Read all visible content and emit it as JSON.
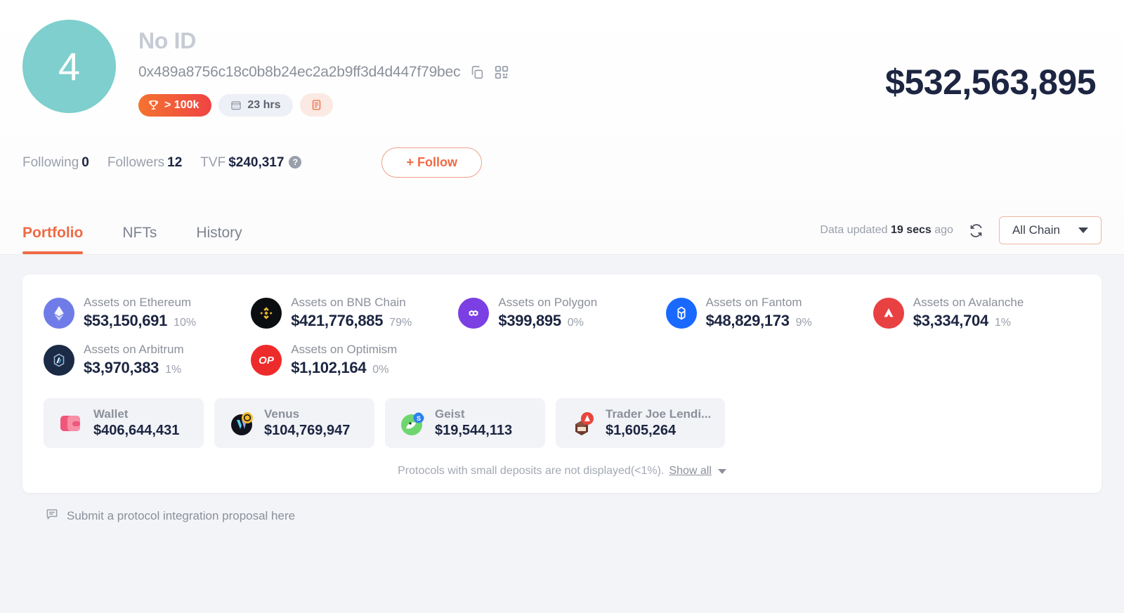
{
  "profile": {
    "avatar_rank": "4",
    "display_name": "No ID",
    "address": "0x489a8756c18c0b8b24ec2a2b9ff3d4d447f79bec",
    "copy_icon": "copy-icon",
    "qr_icon": "qr-code-icon",
    "rank_badge": "> 100k",
    "rank_badge_icon": "trophy-icon",
    "time_badge": "23 hrs",
    "time_badge_icon": "calendar-icon",
    "note_badge_icon": "note-icon",
    "total_value": "$532,563,895"
  },
  "stats": {
    "following_label": "Following",
    "following_value": "0",
    "followers_label": "Followers",
    "followers_value": "12",
    "tvf_label": "TVF",
    "tvf_value": "$240,317",
    "help_icon": "?",
    "follow_button": "+ Follow"
  },
  "tabs": {
    "items": [
      {
        "label": "Portfolio",
        "active": true
      },
      {
        "label": "NFTs",
        "active": false
      },
      {
        "label": "History",
        "active": false
      }
    ],
    "updated_prefix": "Data updated",
    "updated_value": "19 secs",
    "updated_suffix": "ago",
    "refresh_icon": "refresh-icon",
    "chain_filter": "All Chain"
  },
  "chains": [
    {
      "name": "Assets on Ethereum",
      "amount": "$53,150,691",
      "pct": "10%",
      "icon": "ethereum-icon",
      "color": "#6f7ce8"
    },
    {
      "name": "Assets on BNB Chain",
      "amount": "$421,776,885",
      "pct": "79%",
      "icon": "bnb-icon",
      "color": "#0b0e11"
    },
    {
      "name": "Assets on Polygon",
      "amount": "$399,895",
      "pct": "0%",
      "icon": "polygon-icon",
      "color": "#7b3fe4"
    },
    {
      "name": "Assets on Fantom",
      "amount": "$48,829,173",
      "pct": "9%",
      "icon": "fantom-icon",
      "color": "#1969ff"
    },
    {
      "name": "Assets on Avalanche",
      "amount": "$3,334,704",
      "pct": "1%",
      "icon": "avalanche-icon",
      "color": "#e84142"
    },
    {
      "name": "Assets on Arbitrum",
      "amount": "$3,970,383",
      "pct": "1%",
      "icon": "arbitrum-icon",
      "color": "#1b2b45"
    },
    {
      "name": "Assets on Optimism",
      "amount": "$1,102,164",
      "pct": "0%",
      "icon": "optimism-icon",
      "color": "#ee2b2b"
    }
  ],
  "protocols": [
    {
      "name": "Wallet",
      "amount": "$406,644,431",
      "icon": "wallet-icon",
      "color": "#f0567a"
    },
    {
      "name": "Venus",
      "amount": "$104,769,947",
      "icon": "venus-icon",
      "color": "#10131c"
    },
    {
      "name": "Geist",
      "amount": "$19,544,113",
      "icon": "geist-icon",
      "color": "#6fd66f"
    },
    {
      "name": "Trader Joe Lendi...",
      "amount": "$1,605,264",
      "icon": "traderjoe-icon",
      "color": "#e8453c"
    }
  ],
  "footer": {
    "small_note": "Protocols with small deposits are not displayed(<1%).",
    "show_all": "Show all",
    "proposal_icon": "message-icon",
    "proposal_text": "Submit a protocol integration proposal here"
  },
  "theme": {
    "accent": "#ef6a44",
    "dark": "#1c2541",
    "muted": "#8b909a",
    "avatar_bg": "#7ecfcd"
  }
}
